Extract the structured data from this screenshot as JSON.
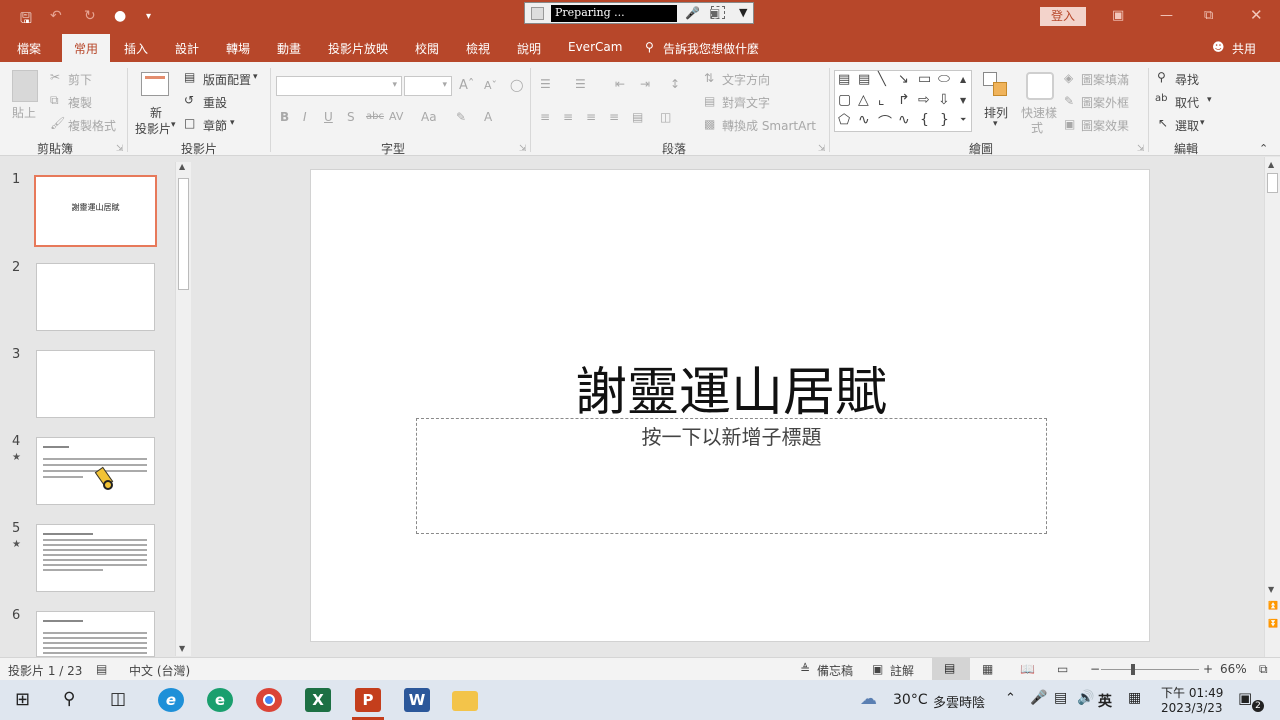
{
  "recorder": {
    "status": "Preparing ..."
  },
  "titlebar": {
    "login_label": "登入"
  },
  "tabs": [
    "檔案",
    "常用",
    "插入",
    "設計",
    "轉場",
    "動畫",
    "投影片放映",
    "校閱",
    "檢視",
    "說明",
    "EverCam"
  ],
  "tell_me": "告訴我您想做什麼",
  "share_label": "共用",
  "ribbon": {
    "clipboard": {
      "paste": "貼上",
      "cut": "剪下",
      "copy": "複製",
      "format_painter": "複製格式",
      "label": "剪貼簿"
    },
    "slides": {
      "new_slide_1": "新",
      "new_slide_2": "投影片",
      "layout": "版面配置",
      "reset": "重設",
      "section": "章節",
      "label": "投影片"
    },
    "font": {
      "label": "字型",
      "bold": "B",
      "italic": "I",
      "underline": "U",
      "shadow": "S",
      "strike": "abc",
      "spacing": "AV",
      "case": "Aa",
      "color": "A"
    },
    "paragraph": {
      "text_direction": "文字方向",
      "align_text": "對齊文字",
      "smartart": "轉換成 SmartArt",
      "label": "段落"
    },
    "drawing": {
      "arrange": "排列",
      "quick_styles_1": "快速樣",
      "quick_styles_2": "式",
      "shape_fill": "圖案填滿",
      "shape_outline": "圖案外框",
      "shape_effects": "圖案效果",
      "label": "繪圖"
    },
    "editing": {
      "find": "尋找",
      "replace": "取代",
      "select": "選取",
      "label": "編輯"
    }
  },
  "thumbnails": [
    {
      "num": "1",
      "title": "謝靈運山居賦",
      "star": ""
    },
    {
      "num": "2",
      "title": "",
      "star": ""
    },
    {
      "num": "3",
      "title": "",
      "star": ""
    },
    {
      "num": "4",
      "title": "",
      "star": "★"
    },
    {
      "num": "5",
      "title": "",
      "star": "★"
    },
    {
      "num": "6",
      "title": "",
      "star": ""
    }
  ],
  "slide": {
    "title": "謝靈運山居賦",
    "subtitle_placeholder": "按一下以新增子標題"
  },
  "status": {
    "slide_counter": "投影片 1 / 23",
    "language": "中文 (台灣)",
    "notes": "備忘稿",
    "comments": "註解",
    "zoom": "66%"
  },
  "taskbar": {
    "weather_temp": "30°C",
    "weather_desc": "多雲時陰",
    "ime": "英",
    "time": "下午 01:49",
    "date": "2023/3/23",
    "notif_count": "2"
  }
}
